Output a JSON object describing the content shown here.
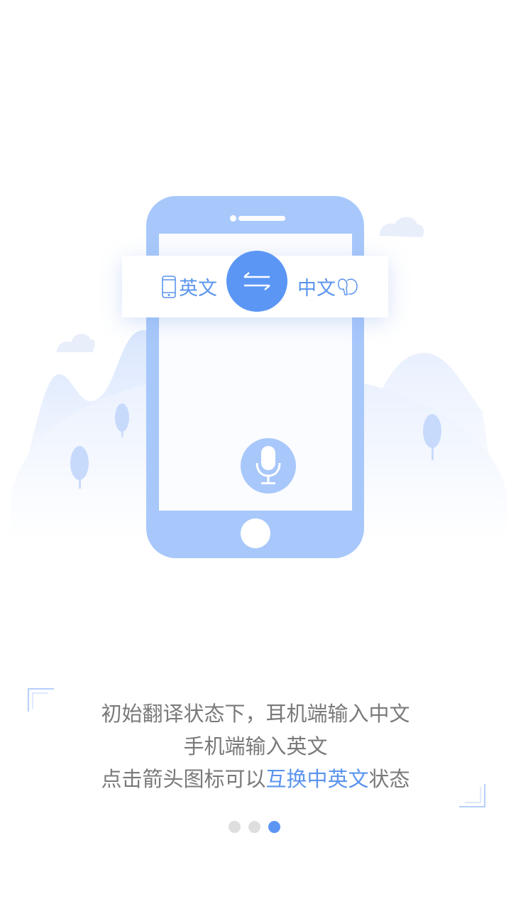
{
  "language_bar": {
    "left_label": "英文",
    "right_label": "中文",
    "left_icon": "phone-icon",
    "right_icon": "earbud-icon",
    "swap_icon": "swap-arrows-icon"
  },
  "phone": {
    "mic_icon": "microphone-icon"
  },
  "caption": {
    "line1": "初始翻译状态下，耳机端输入中文",
    "line2": "手机端输入英文",
    "line3_prefix": "点击箭头图标可以",
    "line3_highlight": "互换中英文",
    "line3_suffix": "状态"
  },
  "pager": {
    "total": 3,
    "active_index": 2
  },
  "colors": {
    "accent": "#5b96f5",
    "phone_body": "#a8c8fb",
    "caption_text": "#7a7a7a",
    "dot_inactive": "#dedede"
  }
}
